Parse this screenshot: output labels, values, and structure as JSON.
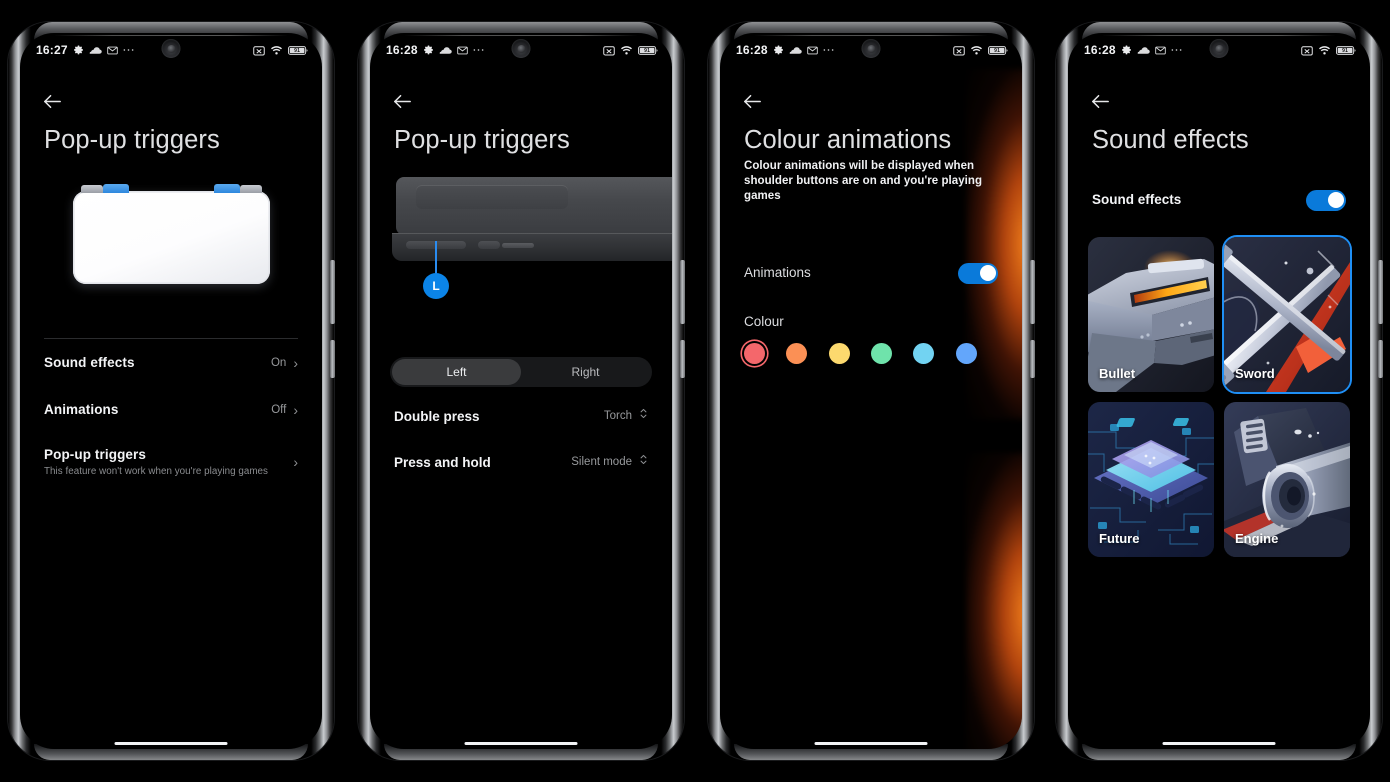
{
  "screens": [
    {
      "status": {
        "time": "16:27",
        "icons": [
          "gear-icon",
          "cloud-icon",
          "mail-icon",
          "more-icon"
        ],
        "right_icons": [
          "no-screenshot-icon",
          "wifi-icon"
        ],
        "battery": "91"
      },
      "title": "Pop-up triggers",
      "rows": [
        {
          "title": "Sound effects",
          "value": "On",
          "chevron": "›"
        },
        {
          "title": "Animations",
          "value": "Off",
          "chevron": "›"
        },
        {
          "title": "Pop-up triggers",
          "desc": "This feature won't work when you're playing games",
          "value": "",
          "chevron": "›"
        }
      ]
    },
    {
      "status": {
        "time": "16:28",
        "battery": "91"
      },
      "title": "Pop-up triggers",
      "pin_label": "L",
      "segments": [
        {
          "label": "Left",
          "selected": true
        },
        {
          "label": "Right",
          "selected": false
        }
      ],
      "rows": [
        {
          "title": "Double press",
          "value": "Torch"
        },
        {
          "title": "Press and hold",
          "value": "Silent mode"
        }
      ]
    },
    {
      "status": {
        "time": "16:28",
        "battery": "91"
      },
      "title": "Colour animations",
      "subtitle": "Colour animations will be displayed when shoulder buttons are on and you're playing games",
      "animations_label": "Animations",
      "animations_on": true,
      "colour_label": "Colour",
      "swatches": [
        {
          "name": "red",
          "hex": "#f4676b",
          "selected": true
        },
        {
          "name": "orange",
          "hex": "#fb9055",
          "selected": false
        },
        {
          "name": "yellow",
          "hex": "#fcd96e",
          "selected": false
        },
        {
          "name": "green",
          "hex": "#6fe3ab",
          "selected": false
        },
        {
          "name": "cyan",
          "hex": "#72d3f2",
          "selected": false
        },
        {
          "name": "blue",
          "hex": "#63a6fb",
          "selected": false
        }
      ],
      "accent": "#0a7ada",
      "glow_colour": "#ff881e"
    },
    {
      "status": {
        "time": "16:28",
        "battery": "91"
      },
      "title": "Sound effects",
      "toggle_label": "Sound effects",
      "toggle_on": true,
      "tiles": [
        {
          "label": "Bullet",
          "selected": false
        },
        {
          "label": "Sword",
          "selected": true
        },
        {
          "label": "Future",
          "selected": false
        },
        {
          "label": "Engine",
          "selected": false
        }
      ],
      "selected_colour": "#1f8ff5"
    }
  ]
}
